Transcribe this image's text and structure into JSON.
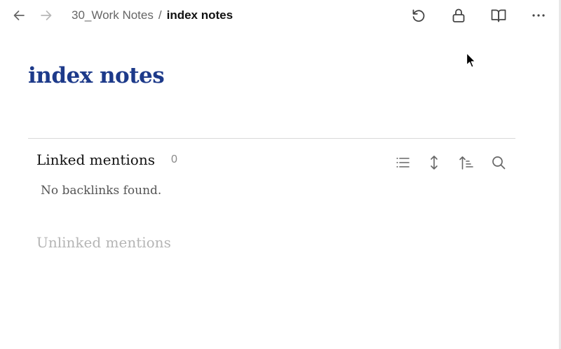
{
  "header": {
    "back_icon": "arrow-left-icon",
    "forward_icon": "arrow-right-icon",
    "breadcrumb": {
      "parent": "30_Work Notes",
      "separator": "/",
      "current": "index notes"
    },
    "tools": [
      "revert-icon",
      "lock-icon",
      "book-open-icon",
      "more-horizontal-icon"
    ]
  },
  "note": {
    "title": "index notes"
  },
  "backlinks": {
    "linked_heading": "Linked mentions",
    "linked_count": "0",
    "tools": [
      "list-collapse-icon",
      "expand-vertical-icon",
      "sort-ascending-icon",
      "search-icon"
    ],
    "empty_message": "No backlinks found.",
    "unlinked_heading": "Unlinked mentions"
  },
  "colors": {
    "title": "#1d3a8a",
    "icon": "#555555",
    "muted": "#b5b5b5"
  }
}
